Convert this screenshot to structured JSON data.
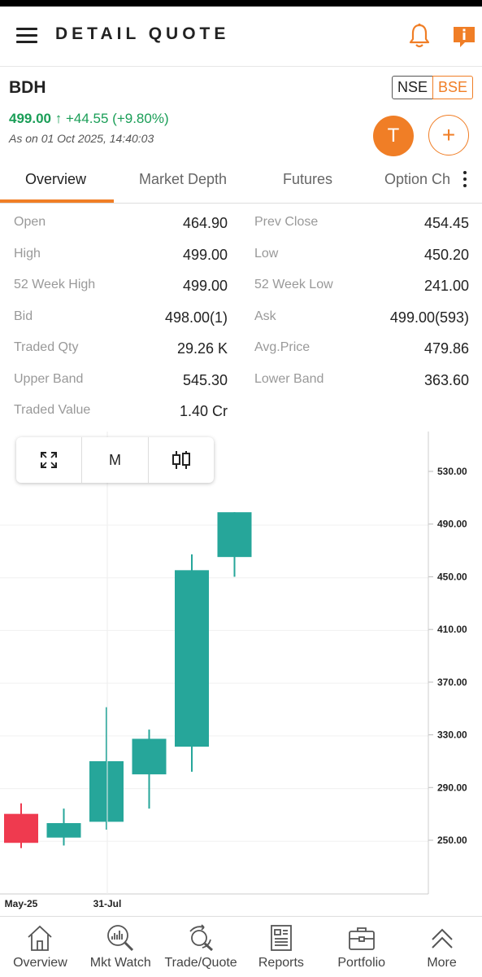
{
  "header": {
    "title": "DETAIL QUOTE"
  },
  "quote": {
    "symbol": "BDH",
    "exchanges": {
      "nse": "NSE",
      "bse": "BSE",
      "selected": "BSE"
    },
    "ltp": "499.00",
    "change_arrow": "↑",
    "change": "+44.55 (+9.80%)",
    "as_on": "As on 01 Oct 2025, 14:40:03",
    "t_button": "T",
    "add_button": "+"
  },
  "tabs": [
    {
      "label": "Overview",
      "active": true
    },
    {
      "label": "Market Depth"
    },
    {
      "label": "Futures"
    },
    {
      "label": "Option Chain"
    }
  ],
  "stats": {
    "left": [
      {
        "k": "Open",
        "v": "464.90"
      },
      {
        "k": "High",
        "v": "499.00"
      },
      {
        "k": "52 Week High",
        "v": "499.00"
      },
      {
        "k": "Bid",
        "v": "498.00(1)"
      },
      {
        "k": "Traded Qty",
        "v": "29.26 K"
      },
      {
        "k": "Upper Band",
        "v": "545.30"
      },
      {
        "k": "Traded Value",
        "v": "1.40 Cr"
      }
    ],
    "right": [
      {
        "k": "Prev Close",
        "v": "454.45"
      },
      {
        "k": "Low",
        "v": "450.20"
      },
      {
        "k": "52 Week Low",
        "v": "241.00"
      },
      {
        "k": "Ask",
        "v": "499.00(593)"
      },
      {
        "k": "Avg.Price",
        "v": "479.86"
      },
      {
        "k": "Lower Band",
        "v": "363.60"
      }
    ]
  },
  "chart_toolbar": {
    "period": "M",
    "expand_icon": "expand-icon",
    "candle_icon": "candlestick-icon"
  },
  "colors": {
    "accent": "#f07e26",
    "up": "#26a69a",
    "down": "#ef3a4f",
    "green_text": "#1a9e57"
  },
  "chart_data": {
    "type": "candlestick",
    "period": "M",
    "ylim": [
      230,
      550
    ],
    "y_ticks": [
      "530.00",
      "490.00",
      "450.00",
      "410.00",
      "370.00",
      "330.00",
      "290.00",
      "250.00"
    ],
    "x_tick_labels": [
      {
        "label": "May-25",
        "index": 0
      },
      {
        "label": "31-Jul",
        "index": 2
      }
    ],
    "candles": [
      {
        "open": 270,
        "high": 278,
        "low": 244,
        "close": 248
      },
      {
        "open": 252,
        "high": 274,
        "low": 246,
        "close": 263
      },
      {
        "open": 264,
        "high": 351,
        "low": 258,
        "close": 310
      },
      {
        "open": 300,
        "high": 334,
        "low": 274,
        "close": 327
      },
      {
        "open": 321,
        "high": 467,
        "low": 302,
        "close": 455
      },
      {
        "open": 465,
        "high": 499,
        "low": 450,
        "close": 499
      }
    ]
  },
  "bottom_nav": [
    {
      "label": "Overview",
      "icon": "home-icon"
    },
    {
      "label": "Mkt Watch",
      "icon": "market-watch-icon"
    },
    {
      "label": "Trade/Quote",
      "icon": "trade-quote-icon"
    },
    {
      "label": "Reports",
      "icon": "reports-icon"
    },
    {
      "label": "Portfolio",
      "icon": "portfolio-icon"
    },
    {
      "label": "More",
      "icon": "more-icon"
    }
  ]
}
